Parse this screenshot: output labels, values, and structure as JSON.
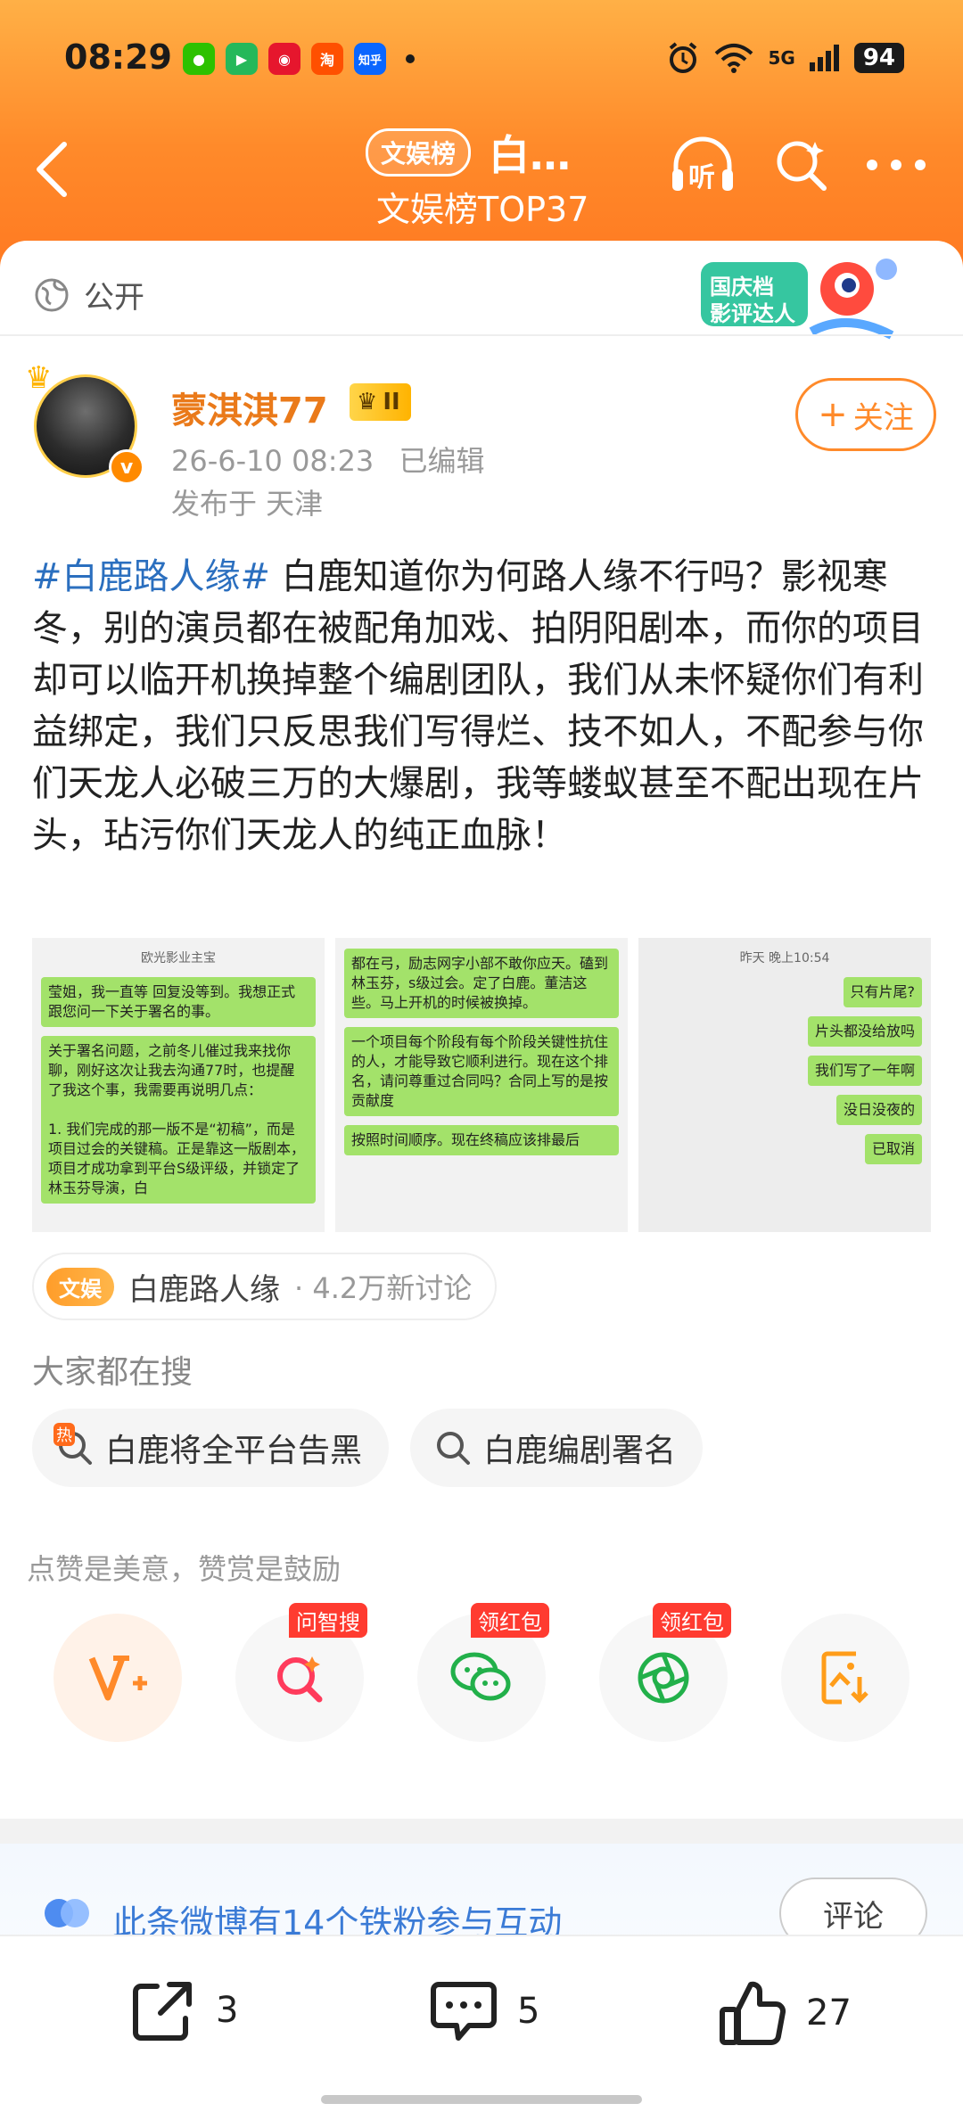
{
  "status_bar": {
    "time": "08:29",
    "network": "5G",
    "battery": "94",
    "app_icons": [
      "wechat-icon",
      "video-app-icon",
      "weibo-icon",
      "taobao-icon",
      "zhihu-icon"
    ],
    "app_labels": {
      "taobao": "淘",
      "zhihu": "知乎"
    }
  },
  "nav": {
    "tag": "文娱榜",
    "title": "白…",
    "subtitle": "文娱榜TOP37",
    "listen_label": "听"
  },
  "visibility": "公开",
  "promo": {
    "line1": "国庆档",
    "line2": "影评达人"
  },
  "author": {
    "name": "蒙淇淇77",
    "level": "II",
    "time": "26-6-10 08:23",
    "edited": "已编辑",
    "location": "发布于 天津",
    "follow_label": "关注",
    "verified": "v"
  },
  "post": {
    "hashtag": "#白鹿路人缘#",
    "text": " 白鹿知道你为何路人缘不行吗？影视寒冬，别的演员都在被配角加戏、拍阴阳剧本，而你的项目却可以临开机换掉整个编剧团队，我们从未怀疑你们有利益绑定，我们只反思我们写得烂、技不如人，不配参与你们天龙人必破三万的大爆剧，我等蝼蚁甚至不配出现在片头，玷污你们天龙人的纯正血脉！"
  },
  "images": {
    "shot1": {
      "header": "欧光影业主宝",
      "bubbles": [
        "莹姐，我一直等  回复没等到。我想正式跟您问一下关于署名的事。",
        "关于署名问题，之前冬儿催过我来找你聊，刚好这次让我去沟通77时，也提醒了我这个事，我需要再说明几点：\n\n1. 我们完成的那一版不是“初稿”，而是项目过会的关键稿。正是靠这一版剧本，项目才成功拿到平台S级评级，并锁定了林玉芬导演，白"
      ]
    },
    "shot2": {
      "bubbles": [
        "都在弓，励志网字小部不敢你应天。磕到林玉芬，s级过会。定了白鹿。董洁这些。马上开机的时候被换掉。",
        "一个项目每个阶段有每个阶段关键性抗住的人，才能导致它顺利进行。现在这个排名，请问尊重过合同吗？合同上写的是按贡献度",
        "按照时间顺序。现在终稿应该排最后"
      ]
    },
    "shot3": {
      "header": "昨天 晚上10:54",
      "bubbles": [
        "只有片尾?",
        "片头都没给放吗",
        "我们写了一年啊",
        "没日没夜的",
        "已取消"
      ]
    }
  },
  "topic": {
    "badge": "文娱",
    "name": "白鹿路人缘",
    "count": "· 4.2万新讨论"
  },
  "search": {
    "title": "大家都在搜",
    "items": [
      "白鹿将全平台告黑",
      "白鹿编剧署名"
    ],
    "hot_label": "热"
  },
  "reward": {
    "text": "点赞是美意，赞赏是鼓励",
    "actions": [
      {
        "icon": "reward-v-icon",
        "tag": ""
      },
      {
        "icon": "ai-search-icon",
        "tag": "问智搜"
      },
      {
        "icon": "wechat-share-icon",
        "tag": "领红包"
      },
      {
        "icon": "moments-share-icon",
        "tag": "领红包"
      },
      {
        "icon": "save-image-icon",
        "tag": ""
      }
    ]
  },
  "fans": {
    "text": "此条微博有14个铁粉参与互动",
    "comment_label": "评论"
  },
  "bottom_bar": {
    "repost": "3",
    "comments": "5",
    "likes": "27"
  },
  "colors": {
    "header_orange": "#ff8a2a",
    "link_blue": "#2b6fbf",
    "name_orange": "#ea7a1a",
    "chat_green": "#a3e26a"
  }
}
